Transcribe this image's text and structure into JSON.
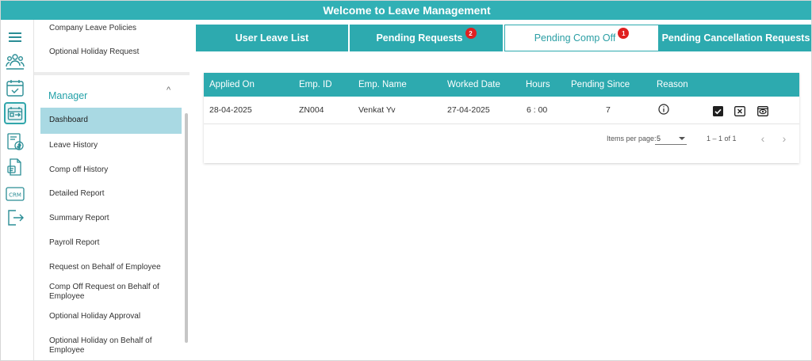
{
  "header": {
    "title": "Welcome to Leave Management"
  },
  "rail": {
    "icons": [
      "menu-icon",
      "team-icon",
      "calendar-check-icon",
      "comp-off-icon",
      "payroll-icon",
      "policy-icon",
      "crm-icon",
      "logout-icon"
    ],
    "crm_label": "CRM"
  },
  "menu": {
    "top_items": [
      "Company Leave Policies",
      "Optional Holiday Request"
    ],
    "section_title": "Manager",
    "caret": "^",
    "items": [
      "Dashboard",
      "Leave History",
      "Comp off History",
      "Detailed Report",
      "Summary Report",
      "Payroll Report",
      "Request on Behalf of Employee",
      "Comp Off Request on Behalf of Employee",
      "Optional Holiday Approval",
      "Optional Holiday on Behalf of Employee"
    ]
  },
  "tabs": [
    {
      "label": "User Leave List",
      "badge": ""
    },
    {
      "label": "Pending Requests",
      "badge": "2"
    },
    {
      "label": "Pending Comp Off",
      "badge": "1",
      "active": true
    },
    {
      "label": "Pending Cancellation Requests",
      "badge": ""
    }
  ],
  "table": {
    "columns": [
      "Applied On",
      "Emp. ID",
      "Emp. Name",
      "Worked Date",
      "Hours",
      "Pending Since",
      "Reason"
    ],
    "rows": [
      {
        "applied_on": "28-04-2025",
        "emp_id": "ZN004",
        "emp_name": "Venkat Yv",
        "worked_date": "27-04-2025",
        "hours": "6 : 00",
        "pending_since": "7"
      }
    ],
    "row_actions": [
      "info-icon",
      "approve-icon",
      "reject-icon",
      "view-icon"
    ]
  },
  "pagination": {
    "items_per_page_label": "Items per page:",
    "page_size": "5",
    "range": "1 – 1 of 1"
  },
  "colors": {
    "primary": "#2daaaf",
    "active_menu": "#a9d9e3",
    "badge": "#e02020",
    "section": "#23a1a8"
  }
}
